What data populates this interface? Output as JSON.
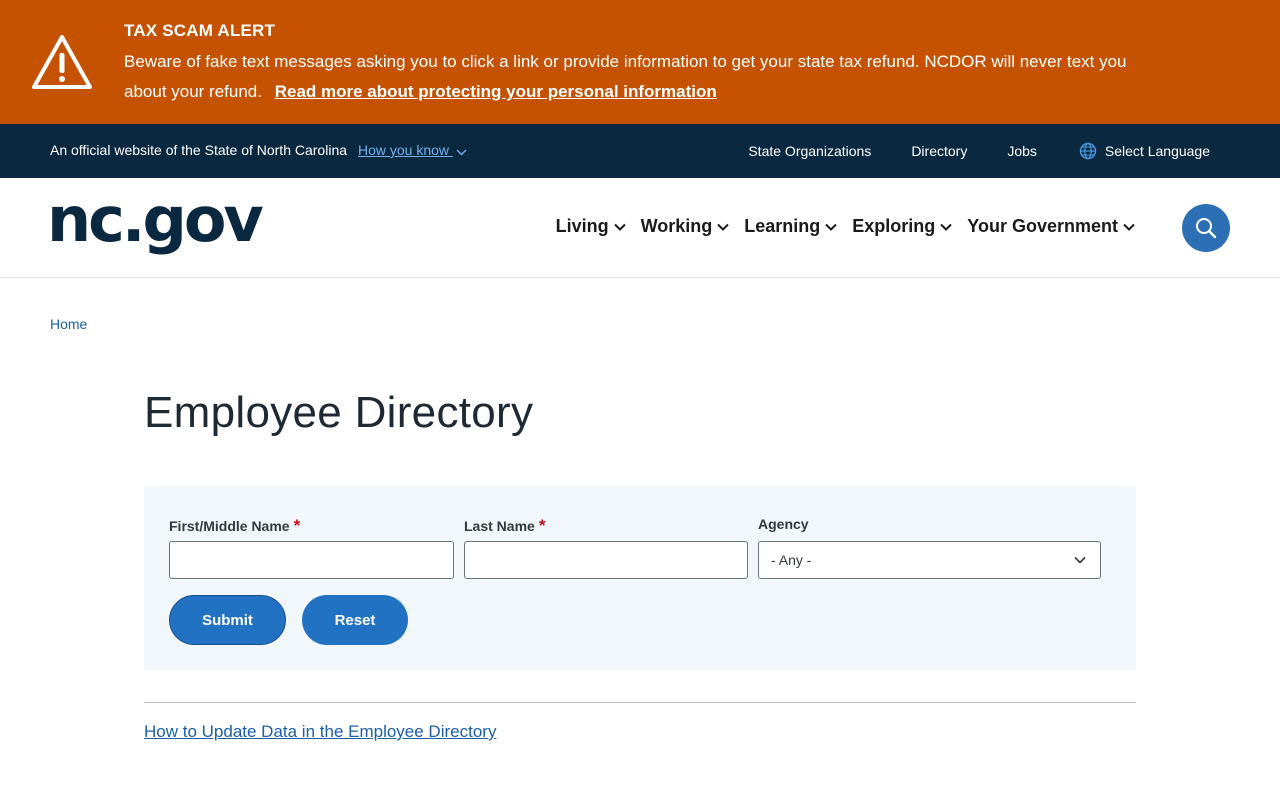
{
  "alert": {
    "title": "TAX SCAM ALERT",
    "message": "Beware of fake text messages asking you to click a link or provide information to get your state tax refund. NCDOR will never text you about your refund.",
    "link_text": "Read more about protecting your personal information",
    "icon": "warning-triangle-icon"
  },
  "utility": {
    "official_text": "An official website of the State of North Carolina",
    "how_know": "How you know",
    "links": [
      "State Organizations",
      "Directory",
      "Jobs"
    ],
    "language": "Select Language"
  },
  "header": {
    "logo": "nc.gov",
    "nav": [
      "Living",
      "Working",
      "Learning",
      "Exploring",
      "Your Government"
    ]
  },
  "breadcrumb": {
    "home": "Home"
  },
  "page": {
    "title": "Employee Directory"
  },
  "form": {
    "first_label": "First/Middle Name",
    "last_label": "Last Name",
    "required_mark": "*",
    "agency_label": "Agency",
    "agency_value": "- Any -",
    "first_value": "",
    "last_value": "",
    "submit": "Submit",
    "reset": "Reset"
  },
  "footer_link": "How to Update Data in the Employee Directory",
  "colors": {
    "alert_bg": "#c55200",
    "utility_bg": "#0b2841",
    "button": "#2272c4",
    "panel_bg": "#f2f7fc",
    "link": "#1a5fa8"
  }
}
